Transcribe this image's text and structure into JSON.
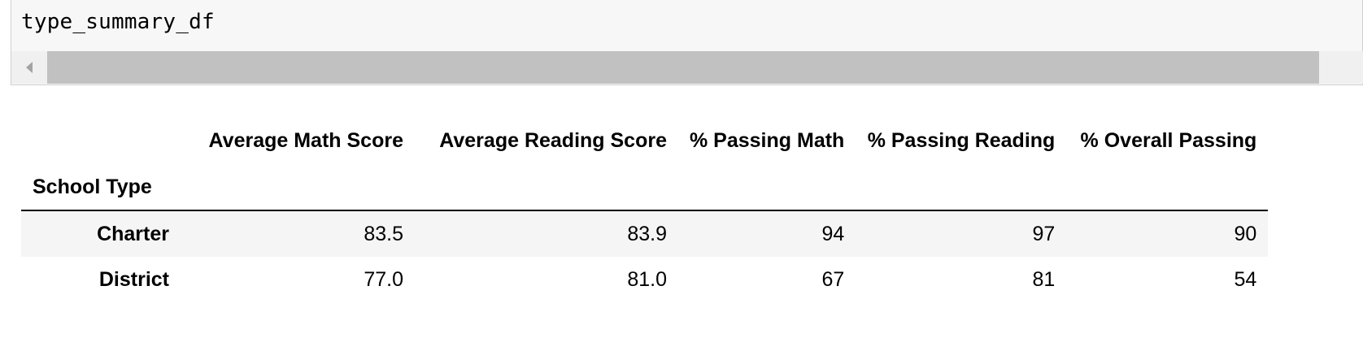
{
  "code_cell": {
    "source": "type_summary_df"
  },
  "table": {
    "columns": [
      "Average Math Score",
      "Average Reading Score",
      "% Passing Math",
      "% Passing Reading",
      "% Overall Passing"
    ],
    "index_name": "School Type",
    "rows": [
      {
        "index": "Charter",
        "values": [
          "83.5",
          "83.9",
          "94",
          "97",
          "90"
        ]
      },
      {
        "index": "District",
        "values": [
          "77.0",
          "81.0",
          "67",
          "81",
          "54"
        ]
      }
    ]
  }
}
